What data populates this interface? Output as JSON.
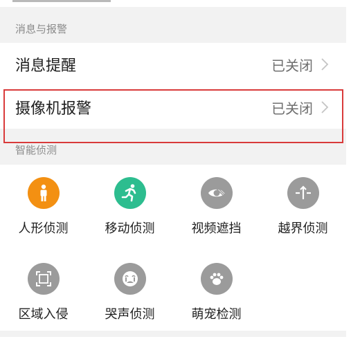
{
  "sections": {
    "messages": {
      "title": "消息与报警"
    },
    "detection": {
      "title": "智能侦测"
    }
  },
  "rows": {
    "notify": {
      "label": "消息提醒",
      "value": "已关闭"
    },
    "camera_alarm": {
      "label": "摄像机报警",
      "value": "已关闭"
    }
  },
  "detection_items": [
    {
      "label": "人形侦测",
      "icon": "person-icon",
      "color": "#f39012"
    },
    {
      "label": "移动侦测",
      "icon": "running-man-icon",
      "color": "#2dbd8f"
    },
    {
      "label": "视频遮挡",
      "icon": "occluded-eye-icon",
      "color": "#9b9b9b"
    },
    {
      "label": "越界侦测",
      "icon": "boundary-cross-icon",
      "color": "#9b9b9b"
    },
    {
      "label": "区域入侵",
      "icon": "region-frame-icon",
      "color": "#9b9b9b"
    },
    {
      "label": "哭声侦测",
      "icon": "crying-face-icon",
      "color": "#9b9b9b"
    },
    {
      "label": "萌宠检测",
      "icon": "paw-icon",
      "color": "#9b9b9b"
    }
  ],
  "colors": {
    "highlight_border": "#d93a3a",
    "section_background": "#f2f2f2",
    "inactive_icon": "#9b9b9b"
  }
}
